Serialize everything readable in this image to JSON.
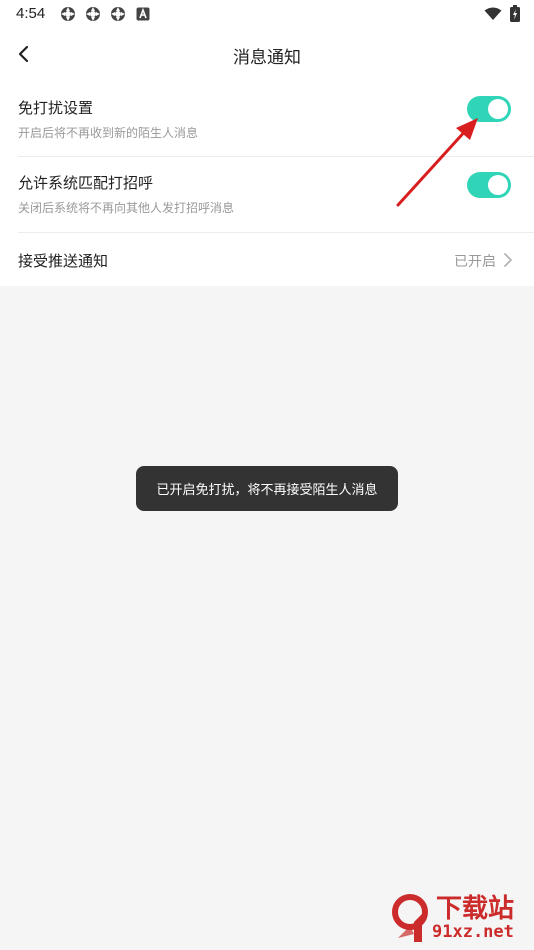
{
  "status_bar": {
    "time": "4:54",
    "left_icons": [
      "settings-icon",
      "settings-icon",
      "settings-icon",
      "a-box-icon"
    ],
    "right_icons": [
      "wifi-icon",
      "battery-charging-icon"
    ]
  },
  "header": {
    "back_icon": "chevron-left-icon",
    "title": "消息通知"
  },
  "settings": {
    "items": [
      {
        "title": "免打扰设置",
        "subtitle": "开启后将不再收到新的陌生人消息",
        "toggle_on": true
      },
      {
        "title": "允许系统匹配打招呼",
        "subtitle": "关闭后系统将不再向其他人发打招呼消息",
        "toggle_on": true
      },
      {
        "title": "接受推送通知",
        "value": "已开启",
        "chevron_icon": "chevron-right-icon"
      }
    ]
  },
  "toast": {
    "text": "已开启免打扰，将不再接受陌生人消息"
  },
  "watermark": {
    "top_text": "下载站",
    "bottom_text": "91xz.net"
  },
  "colors": {
    "accent": "#30d5b8",
    "annotation_arrow": "#d81e1e",
    "toast_bg": "#333333",
    "watermark": "#cc2b2b"
  }
}
